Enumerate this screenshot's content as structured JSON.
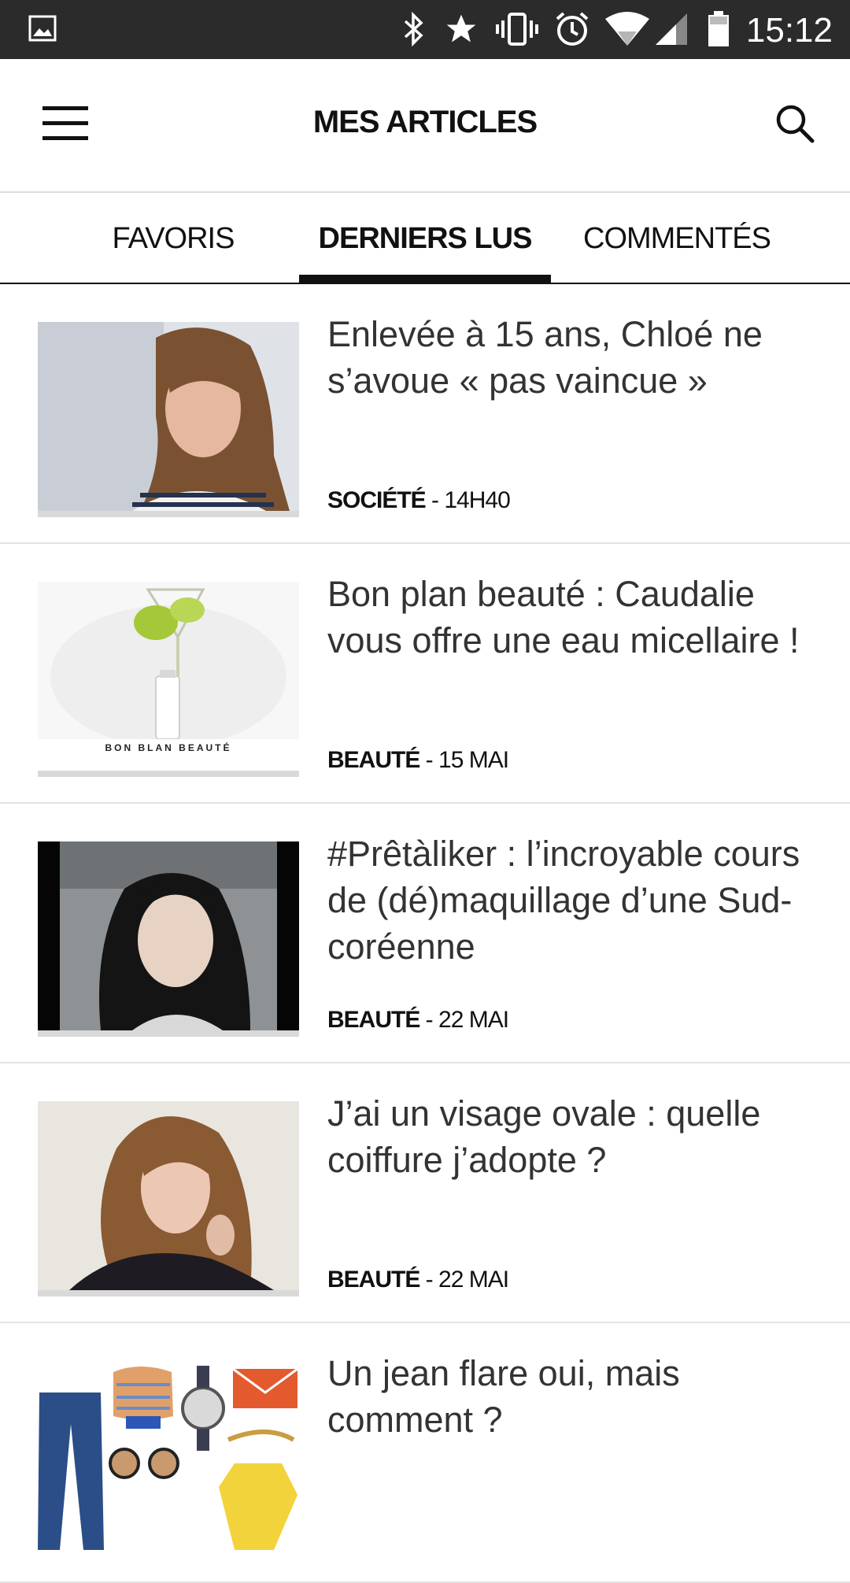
{
  "status_bar": {
    "time": "15:12",
    "icons": [
      "image-icon",
      "bluetooth-icon",
      "star-icon",
      "vibrate-icon",
      "alarm-icon",
      "wifi-icon",
      "signal-icon",
      "battery-icon"
    ]
  },
  "app_bar": {
    "title": "MES ARTICLES",
    "menu_icon": "hamburger-menu-icon",
    "search_icon": "search-icon"
  },
  "tabs": [
    {
      "label": "FAVORIS",
      "active": false
    },
    {
      "label": "DERNIERS LUS",
      "active": true
    },
    {
      "label": "COMMENTÉS",
      "active": false
    }
  ],
  "articles": [
    {
      "title": "Enlevée à 15 ans, Chloé ne s’avoue « pas vaincue »",
      "category": "SOCIÉTÉ",
      "date": " - 14H40",
      "thumb_label": ""
    },
    {
      "title": "Bon plan beauté : Caudalie vous offre une eau micellaire !",
      "category": "BEAUTÉ",
      "date": " - 15 MAI",
      "thumb_label": "BON BLAN BEAUTÉ"
    },
    {
      "title": " #Prêtàliker : l’incroyable cours de (dé)maquillage d’une Sud-coréenne",
      "category": "BEAUTÉ",
      "date": " - 22 MAI",
      "thumb_label": ""
    },
    {
      "title": "J’ai un visage ovale : quelle coiffure j’adopte ?",
      "category": "BEAUTÉ",
      "date": " - 22 MAI",
      "thumb_label": ""
    },
    {
      "title": "Un jean flare oui, mais comment ?",
      "category": "",
      "date": "",
      "thumb_label": ""
    }
  ]
}
